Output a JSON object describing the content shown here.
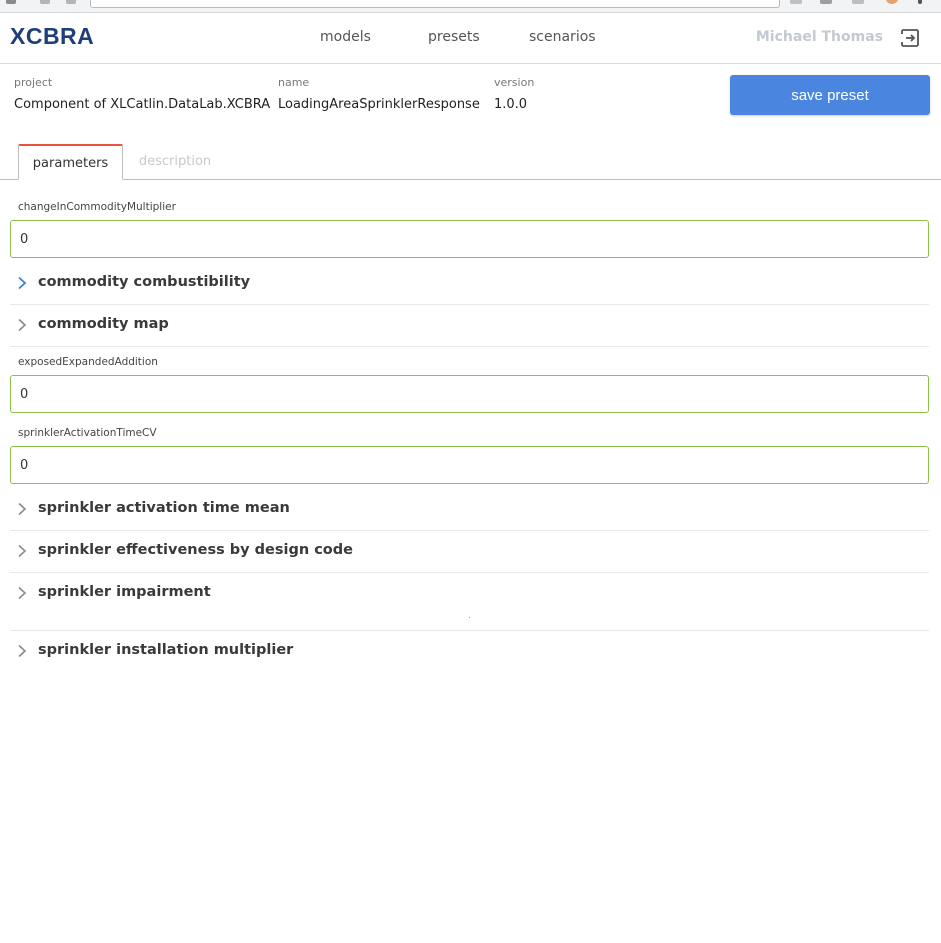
{
  "header": {
    "logo": "XCBRA",
    "nav": [
      "models",
      "presets",
      "scenarios"
    ],
    "user_name": "Michael Thomas",
    "logout_icon": "logout-icon"
  },
  "meta": {
    "project_label": "project",
    "project_value": "Component of XLCatlin.DataLab.XCBRA",
    "name_label": "name",
    "name_value": "LoadingAreaSprinklerResponse",
    "version_label": "version",
    "version_value": "1.0.0"
  },
  "actions": {
    "save_label": "save preset"
  },
  "tabs": [
    "parameters",
    "description"
  ],
  "form": {
    "changeInCommodityMultiplier": {
      "label": "changeInCommodityMultiplier",
      "value": "0"
    },
    "commodity_combustibility": "commodity combustibility",
    "commodity_map": "commodity map",
    "exposedExpandedAddition": {
      "label": "exposedExpandedAddition",
      "value": "0"
    },
    "sprinklerActivationTimeCV": {
      "label": "sprinklerActivationTimeCV",
      "value": "0"
    },
    "sprinkler_activation_time_mean": "sprinkler activation time mean",
    "sprinkler_effectiveness": "sprinkler effectiveness by design code",
    "sprinkler_impairment": "sprinkler impairment",
    "sprinkler_installation_multiplier": "sprinkler installation multiplier"
  },
  "colors": {
    "accent": "#4a86e0",
    "logo": "#203f7a",
    "tab_indicator": "#e8553c",
    "input_border": "#8bc34a",
    "chevron_active": "#3b82d4",
    "chevron": "#8a8a8a"
  }
}
